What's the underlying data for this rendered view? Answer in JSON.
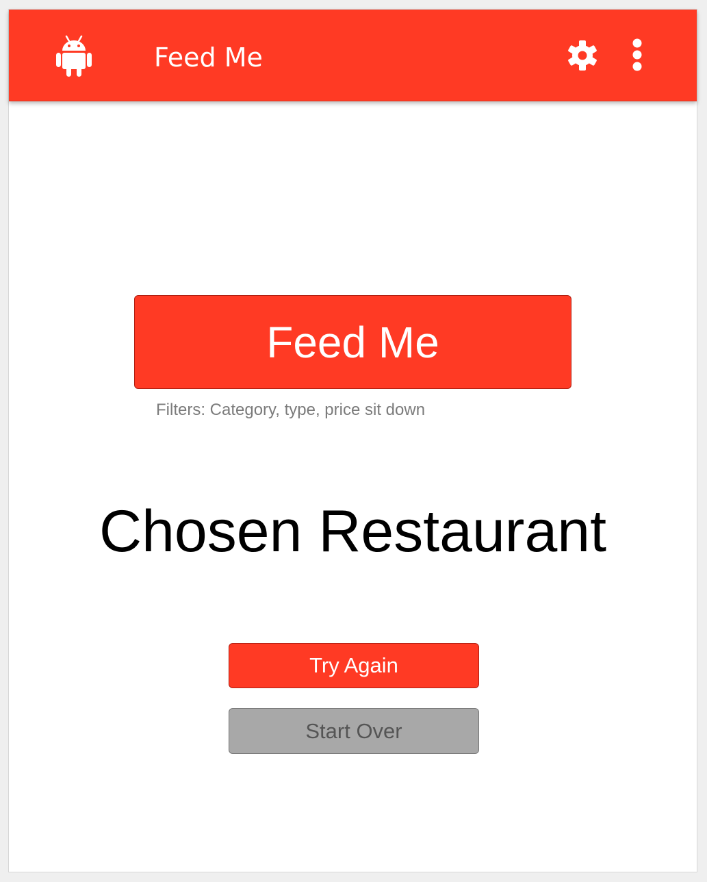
{
  "app_bar": {
    "title": "Feed Me",
    "background_color": "#ff3a24",
    "logo_icon": "android-icon",
    "actions": [
      {
        "icon": "gear-icon",
        "label": "settings"
      },
      {
        "icon": "more-vert-icon",
        "label": "more options"
      }
    ]
  },
  "main": {
    "feed_button_label": "Feed Me",
    "filters_text": "Filters: Category, type, price sit down",
    "result_text": "Chosen Restaurant",
    "try_again_label": "Try Again",
    "start_over_label": "Start Over"
  },
  "colors": {
    "accent": "#ff3a24",
    "disabled_button": "#a8a8a8",
    "muted_text": "#7b7b7b"
  }
}
